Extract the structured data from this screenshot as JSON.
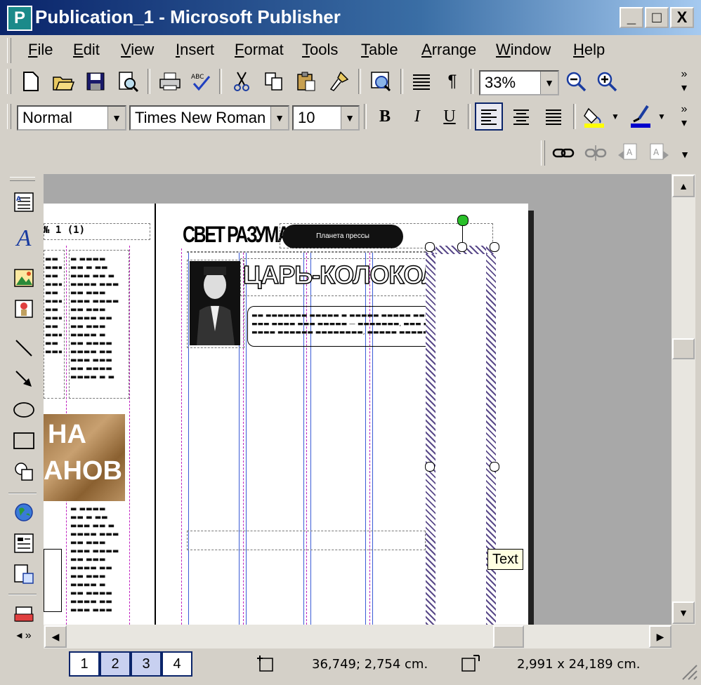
{
  "window": {
    "title": "Publication_1 - Microsoft Publisher",
    "app_icon": "P",
    "controls": [
      "_",
      "□",
      "X"
    ]
  },
  "menu": [
    "File",
    "Edit",
    "View",
    "Insert",
    "Format",
    "Tools",
    "Table",
    "Arrange",
    "Window",
    "Help"
  ],
  "toolbar_standard": {
    "zoom_value": "33%"
  },
  "toolbar_format": {
    "style_value": "Normal",
    "font_value": "Times New Roman",
    "size_value": "10",
    "bold": "B",
    "italic": "I",
    "underline": "U",
    "fill_color": "#ffff00",
    "line_color": "#0000cc"
  },
  "document": {
    "masthead": "СВЕТ РАЗУМА",
    "pill_text": "Планета прессы",
    "headline": "ЦАРЬ-КОЛОКОЛ",
    "left_header": "№ 1 (1)",
    "left_banner_line1": "НА",
    "left_banner_line2": "АНОВ",
    "tooltip": "Text"
  },
  "statusbar": {
    "pages": [
      "1",
      "2",
      "3",
      "4"
    ],
    "active_page": "1",
    "position": "36,749; 2,754 cm.",
    "size": "2,991 x 24,189 cm."
  }
}
